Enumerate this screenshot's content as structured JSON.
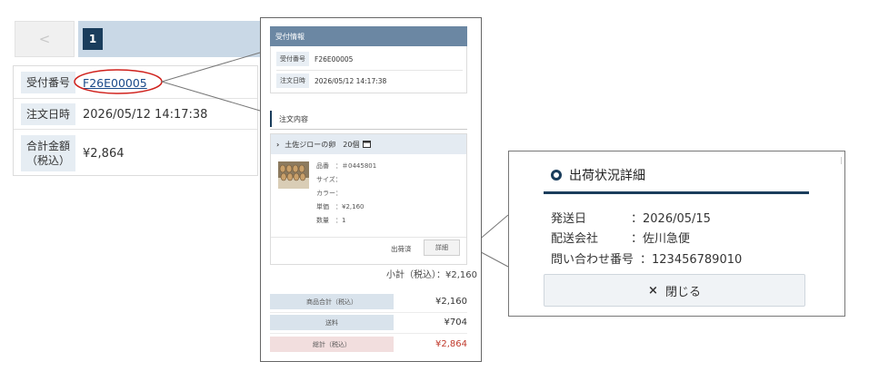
{
  "pager": {
    "prev_icon": "chevron-left-icon",
    "prev_glyph": "<",
    "current_page": "1"
  },
  "order_summary": {
    "rows": [
      {
        "label": "受付番号",
        "value": "F26E00005"
      },
      {
        "label": "注文日時",
        "value": "2026/05/12 14:17:38"
      },
      {
        "label": "合計金額\n（税込）",
        "value": "¥2,864"
      }
    ]
  },
  "receipt_popup": {
    "section_title": "受付情報",
    "rows": [
      {
        "label": "受付番号",
        "value": "F26E00005"
      },
      {
        "label": "注文日時",
        "value": "2026/05/12 14:17:38"
      }
    ],
    "order_title": "注文内容",
    "product": {
      "name": "土佐ジローの卵　20個",
      "specs": [
        "品番　：＃0445801",
        "サイズ：",
        "カラー：",
        "単価　：¥2,160",
        "数量　：1"
      ],
      "status": "出荷済",
      "detail_button": "詳細",
      "subtotal": "小計（税込）：¥2,160"
    },
    "summary": [
      {
        "label": "商品合計（税込）",
        "value": "¥2,160",
        "color": "#d9e3ec"
      },
      {
        "label": "送料",
        "value": "¥704",
        "color": "#d9e3ec"
      },
      {
        "label": "総計（税込）",
        "value": "¥2,864",
        "color": "#f2dede"
      }
    ]
  },
  "shipping_popup": {
    "title": "出荷状況詳細",
    "rows": [
      {
        "label": "発送日",
        "value": "：2026/05/15"
      },
      {
        "label": "配送会社",
        "value": "：佐川急便"
      },
      {
        "label": "問い合わせ番号",
        "value": "：123456789010"
      }
    ],
    "close_glyph": "×",
    "close_label": "閉じる"
  },
  "colors": {
    "navy": "#1a3d5c",
    "highlight_red": "#d0211c"
  }
}
